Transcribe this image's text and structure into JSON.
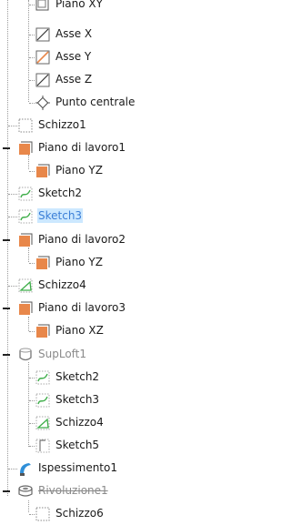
{
  "tree": {
    "items": [
      {
        "label": "Piano XY",
        "icon": "plane-icon"
      },
      {
        "label": "Asse X",
        "icon": "axis-icon"
      },
      {
        "label": "Asse Y",
        "icon": "axis-icon-highlight"
      },
      {
        "label": "Asse Z",
        "icon": "axis-icon"
      },
      {
        "label": "Punto centrale",
        "icon": "center-point-icon"
      },
      {
        "label": "Schizzo1",
        "icon": "sketch-empty-icon"
      },
      {
        "label": "Piano di lavoro1",
        "icon": "workplane-icon",
        "expanded": true
      },
      {
        "label": "Piano YZ",
        "icon": "workplane-icon"
      },
      {
        "label": "Sketch2",
        "icon": "sketch-curve-icon"
      },
      {
        "label": "Sketch3",
        "icon": "sketch-curve-icon",
        "selected": true
      },
      {
        "label": "Piano di lavoro2",
        "icon": "workplane-icon",
        "expanded": true
      },
      {
        "label": "Piano YZ",
        "icon": "workplane-icon"
      },
      {
        "label": "Schizzo4",
        "icon": "sketch-icon"
      },
      {
        "label": "Piano di lavoro3",
        "icon": "workplane-icon",
        "expanded": true
      },
      {
        "label": "Piano XZ",
        "icon": "workplane-icon"
      },
      {
        "label": "SupLoft1",
        "icon": "loft-surface-icon",
        "expanded": true,
        "dimmed": true
      },
      {
        "label": "Sketch2",
        "icon": "sketch-curve-icon"
      },
      {
        "label": "Sketch3",
        "icon": "sketch-curve-icon"
      },
      {
        "label": "Schizzo4",
        "icon": "sketch-icon"
      },
      {
        "label": "Sketch5",
        "icon": "sketch-curve-icon"
      },
      {
        "label": "Ispessimento1",
        "icon": "thicken-icon"
      },
      {
        "label": "Rivoluzione1",
        "icon": "revolve-icon",
        "expanded": true,
        "suppressed": true
      },
      {
        "label": "Schizzo6",
        "icon": "sketch-empty-icon"
      }
    ]
  },
  "colors": {
    "selection_bg": "#cce8ff",
    "selection_text": "#3c7fd7",
    "workplane_orange": "#e8874a",
    "sketch_green": "#3fae4a",
    "thicken_blue": "#2f8fd8"
  }
}
